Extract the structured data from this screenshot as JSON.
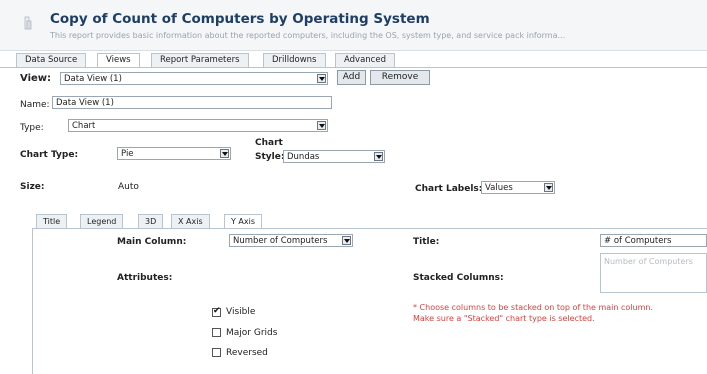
{
  "report": {
    "title": "Copy of Count of Computers by Operating System",
    "description": "This report provides basic information about the reported computers, including the OS, system type, and service pack informa..."
  },
  "tabs": [
    {
      "label": "Data Source",
      "active": false
    },
    {
      "label": "Views",
      "active": true
    },
    {
      "label": "Report Parameters",
      "active": false
    },
    {
      "label": "Drilldowns",
      "active": false
    },
    {
      "label": "Advanced",
      "active": false
    }
  ],
  "view": {
    "label": "View:",
    "selected": "Data View (1)",
    "add_label": "Add",
    "remove_label": "Remove"
  },
  "name": {
    "label": "Name:",
    "value": "Data View (1)"
  },
  "type": {
    "label": "Type:",
    "selected": "Chart"
  },
  "chart_type": {
    "label": "Chart Type:",
    "selected": "Pie"
  },
  "chart_style": {
    "label_line1": "Chart",
    "label_line2": "Style:",
    "selected": "Dundas"
  },
  "size": {
    "label": "Size:",
    "value": "Auto"
  },
  "chart_labels": {
    "label": "Chart Labels:",
    "selected": "Values"
  },
  "inner_tabs": [
    {
      "label": "Title",
      "active": false
    },
    {
      "label": "Legend",
      "active": false
    },
    {
      "label": "3D",
      "active": false
    },
    {
      "label": "X Axis",
      "active": false
    },
    {
      "label": "Y Axis",
      "active": true
    }
  ],
  "y_axis": {
    "main_column_label": "Main Column:",
    "main_column_selected": "Number of Computers",
    "title_label": "Title:",
    "title_value": "# of Computers",
    "attributes_label": "Attributes:",
    "stacked_label": "Stacked Columns:",
    "stacked_placeholder": "Number of Computers",
    "note_line1": "* Choose columns to be stacked on top of the main column.",
    "note_line2": "Make sure a \"Stacked\" chart type is selected.",
    "checkboxes": [
      {
        "label": "Visible",
        "checked": true
      },
      {
        "label": "Major Grids",
        "checked": false
      },
      {
        "label": "Reversed",
        "checked": false
      }
    ]
  },
  "colors": {
    "title": "#1e3e66",
    "note": "#d94040",
    "border": "#b8c4d0"
  }
}
